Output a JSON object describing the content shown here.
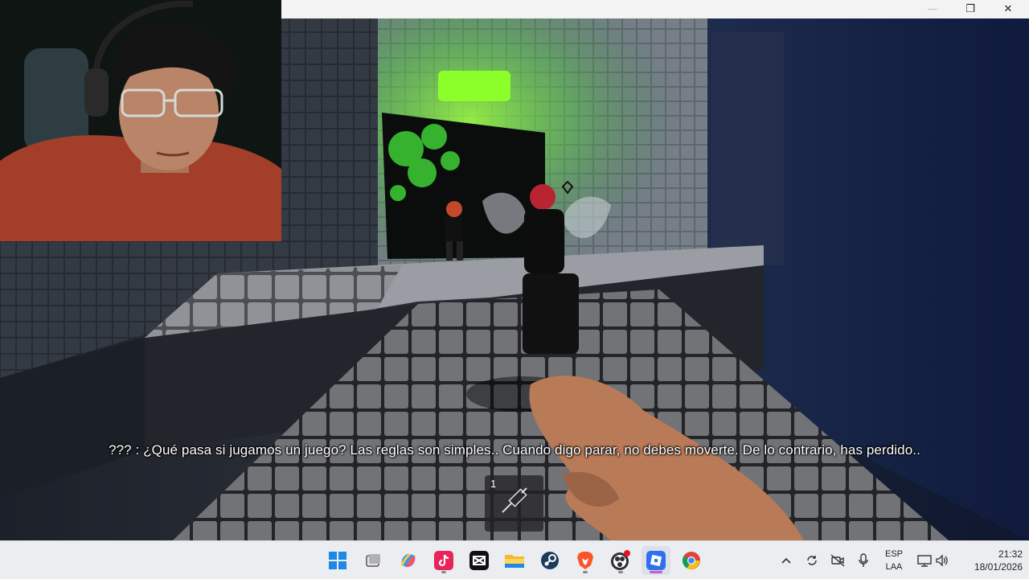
{
  "game": {
    "subtitle": "??? : ¿Qué pasa si jugamos un juego? Las reglas son simples.. Cuando digo parar, no debes moverte. De lo contrario, has perdido..",
    "hotbar": {
      "slot_number": "1",
      "item_icon": "syringe-icon"
    }
  },
  "window": {
    "controls": {
      "minimize": "—",
      "restore": "❐",
      "close": "✕"
    }
  },
  "taskbar": {
    "apps": [
      {
        "name": "start",
        "icon": "windows-start-icon"
      },
      {
        "name": "task-view",
        "icon": "task-view-icon"
      },
      {
        "name": "copilot",
        "icon": "copilot-icon"
      },
      {
        "name": "tiktok",
        "icon": "tiktok-icon"
      },
      {
        "name": "capcut",
        "icon": "capcut-icon"
      },
      {
        "name": "file-explorer",
        "icon": "folder-icon"
      },
      {
        "name": "steam",
        "icon": "steam-icon"
      },
      {
        "name": "brave",
        "icon": "brave-icon"
      },
      {
        "name": "obs",
        "icon": "obs-icon"
      },
      {
        "name": "roblox",
        "icon": "roblox-icon",
        "active": true
      },
      {
        "name": "chrome",
        "icon": "chrome-icon"
      }
    ],
    "tray": {
      "lang_line1": "ESP",
      "lang_line2": "LAA",
      "time": "21:32",
      "date": "18/01/2026"
    }
  },
  "colors": {
    "accent_green": "#7cff3a",
    "taskbar_bg": "#ecedf1",
    "active_indicator": "#c05cd8"
  }
}
